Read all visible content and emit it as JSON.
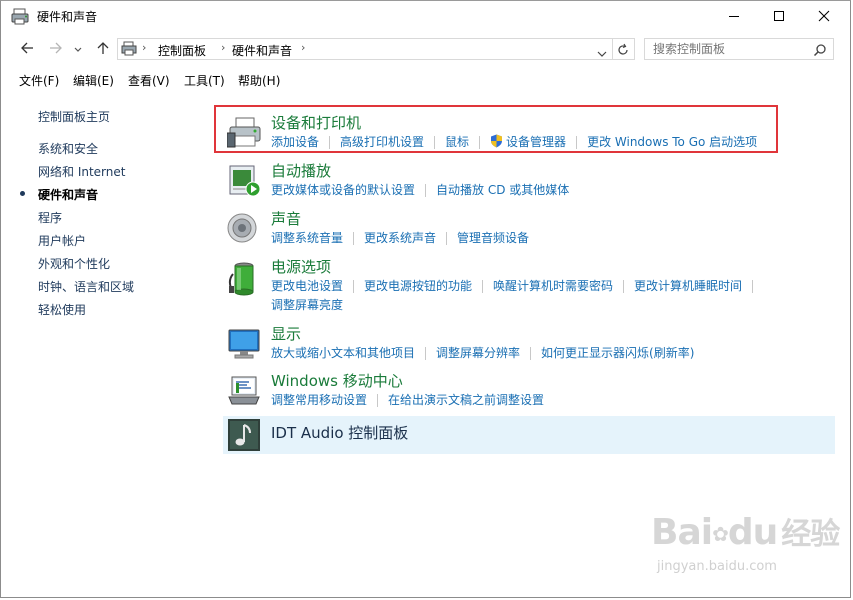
{
  "window": {
    "title": "硬件和声音",
    "minimize_icon": "minimize-icon",
    "maximize_icon": "maximize-icon",
    "close_icon": "close-icon"
  },
  "nav": {
    "back_icon": "arrow-left-icon",
    "forward_icon": "arrow-right-icon",
    "recent_icon": "chevron-down-icon",
    "up_icon": "arrow-up-icon",
    "breadcrumbs": [
      "控制面板",
      "硬件和声音"
    ],
    "refresh_icon": "refresh-icon",
    "search_placeholder": "搜索控制面板"
  },
  "menu": [
    "文件(F)",
    "编辑(E)",
    "查看(V)",
    "工具(T)",
    "帮助(H)"
  ],
  "sidebar": {
    "home": "控制面板主页",
    "items": [
      {
        "label": "系统和安全",
        "active": false
      },
      {
        "label": "网络和 Internet",
        "active": false
      },
      {
        "label": "硬件和声音",
        "active": true
      },
      {
        "label": "程序",
        "active": false
      },
      {
        "label": "用户帐户",
        "active": false
      },
      {
        "label": "外观和个性化",
        "active": false
      },
      {
        "label": "时钟、语言和区域",
        "active": false
      },
      {
        "label": "轻松使用",
        "active": false
      }
    ]
  },
  "categories": [
    {
      "title": "设备和打印机",
      "icon": "printer-icon",
      "links": [
        "添加设备",
        "高级打印机设置",
        "鼠标",
        "设备管理器",
        "更改 Windows To Go 启动选项"
      ]
    },
    {
      "title": "自动播放",
      "icon": "autoplay-icon",
      "links": [
        "更改媒体或设备的默认设置",
        "自动播放 CD 或其他媒体"
      ]
    },
    {
      "title": "声音",
      "icon": "speaker-icon",
      "links": [
        "调整系统音量",
        "更改系统声音",
        "管理音频设备"
      ]
    },
    {
      "title": "电源选项",
      "icon": "battery-icon",
      "links": [
        "更改电池设置",
        "更改电源按钮的功能",
        "唤醒计算机时需要密码",
        "更改计算机睡眠时间"
      ],
      "links2": [
        "调整屏幕亮度"
      ]
    },
    {
      "title": "显示",
      "icon": "monitor-icon",
      "links": [
        "放大或缩小文本和其他项目",
        "调整屏幕分辨率",
        "如何更正显示器闪烁(刷新率)"
      ]
    },
    {
      "title": "Windows 移动中心",
      "icon": "mobility-center-icon",
      "links": [
        "调整常用移动设置",
        "在给出演示文稿之前调整设置"
      ]
    },
    {
      "title": "IDT Audio 控制面板",
      "icon": "music-note-icon",
      "links": []
    }
  ],
  "watermark": {
    "brand": "Bai",
    "brand2": "du",
    "brand_cn": "经验",
    "url": "jingyan.baidu.com"
  }
}
